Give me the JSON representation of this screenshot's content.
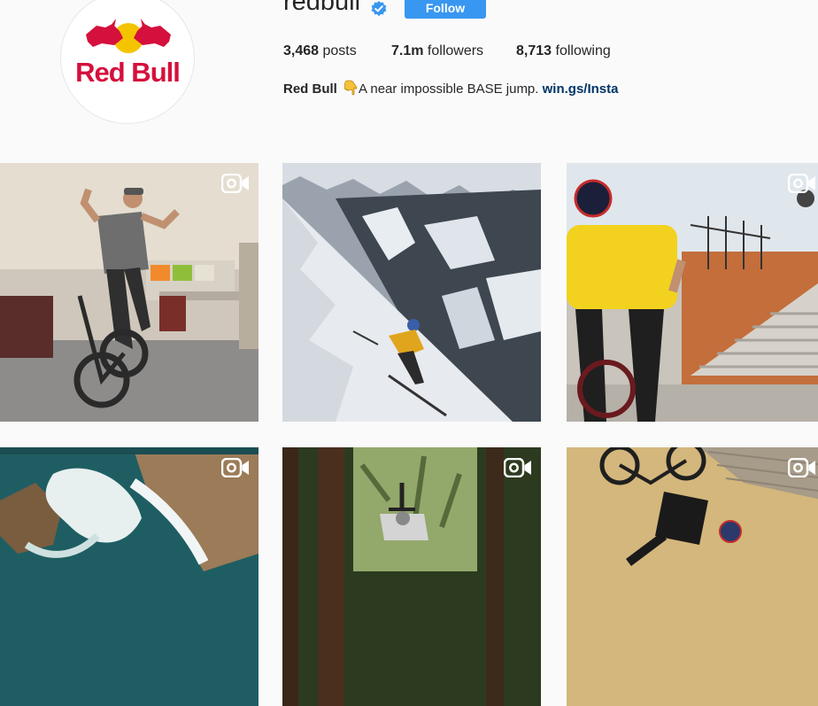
{
  "profile": {
    "username": "redbull",
    "follow_label": "Follow",
    "avatar_logo_text": "Red Bull",
    "stats": {
      "posts_count": "3,468",
      "posts_label": "posts",
      "followers_count": "7.1m",
      "followers_label": "followers",
      "following_count": "8,713",
      "following_label": "following"
    },
    "bio": {
      "name": "Red Bull",
      "emoji_icon": "hand-pointing-down-icon",
      "text": "A near impossible BASE jump.",
      "link": "win.gs/Insta"
    }
  },
  "colors": {
    "follow_button": "#3897f0",
    "link": "#003569",
    "verified": "#3897f0",
    "brand_red": "#d5103c",
    "brand_yellow": "#f5c400"
  },
  "posts": [
    {
      "scene": "BMX rider doing a trick in a hotel room",
      "media": "video"
    },
    {
      "scene": "Skier descending a steep snowy mountain face",
      "media": "photo"
    },
    {
      "scene": "BMX rider in yellow shirt near concrete stairs",
      "media": "video"
    },
    {
      "scene": "Aerial view of ocean waves on a rocky coast",
      "media": "video"
    },
    {
      "scene": "Mountain biker jumping in a forest",
      "media": "video"
    },
    {
      "scene": "BMX rider upside down on a wall ride",
      "media": "video"
    }
  ]
}
